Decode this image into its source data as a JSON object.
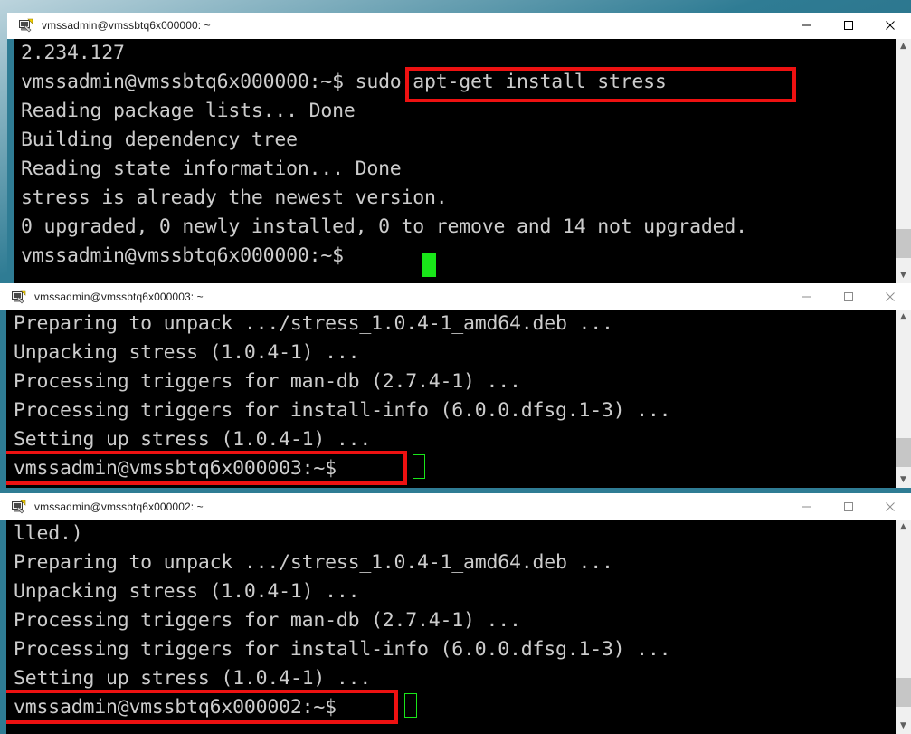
{
  "desktop": {
    "background_color": "#2f7c94"
  },
  "window_controls": {
    "minimize_label": "Minimize",
    "maximize_label": "Maximize",
    "close_label": "Close"
  },
  "windows": [
    {
      "title": "vmssadmin@vmssbtq6x000000: ~",
      "icon": "putty-terminal-icon",
      "active": true,
      "lines": [
        "2.234.127",
        "vmssadmin@vmssbtq6x000000:~$ sudo apt-get install stress",
        "Reading package lists... Done",
        "Building dependency tree",
        "Reading state information... Done",
        "stress is already the newest version.",
        "0 upgraded, 0 newly installed, 0 to remove and 14 not upgraded.",
        "vmssadmin@vmssbtq6x000000:~$ "
      ],
      "highlight": {
        "text": "sudo apt-get install stress",
        "color": "#ee1111"
      },
      "cursor": {
        "type": "solid",
        "color": "#19e619"
      }
    },
    {
      "title": "vmssadmin@vmssbtq6x000003: ~",
      "icon": "putty-terminal-icon",
      "active": false,
      "lines": [
        "Preparing to unpack .../stress_1.0.4-1_amd64.deb ...",
        "Unpacking stress (1.0.4-1) ...",
        "Processing triggers for man-db (2.7.4-1) ...",
        "Processing triggers for install-info (6.0.0.dfsg.1-3) ...",
        "Setting up stress (1.0.4-1) ...",
        "vmssadmin@vmssbtq6x000003:~$ "
      ],
      "highlight": {
        "text": "vmssadmin@vmssbtq6x000003:~$",
        "color": "#ee1111"
      },
      "cursor": {
        "type": "hollow",
        "color": "#19e619"
      }
    },
    {
      "title": "vmssadmin@vmssbtq6x000002: ~",
      "icon": "putty-terminal-icon",
      "active": false,
      "lines": [
        "lled.)",
        "Preparing to unpack .../stress_1.0.4-1_amd64.deb ...",
        "Unpacking stress (1.0.4-1) ...",
        "Processing triggers for man-db (2.7.4-1) ...",
        "Processing triggers for install-info (6.0.0.dfsg.1-3) ...",
        "Setting up stress (1.0.4-1) ...",
        "vmssadmin@vmssbtq6x000002:~$ "
      ],
      "highlight": {
        "text": "vmssadmin@vmssbtq6x000002:~$",
        "color": "#ee1111"
      },
      "cursor": {
        "type": "hollow",
        "color": "#19e619"
      }
    }
  ]
}
